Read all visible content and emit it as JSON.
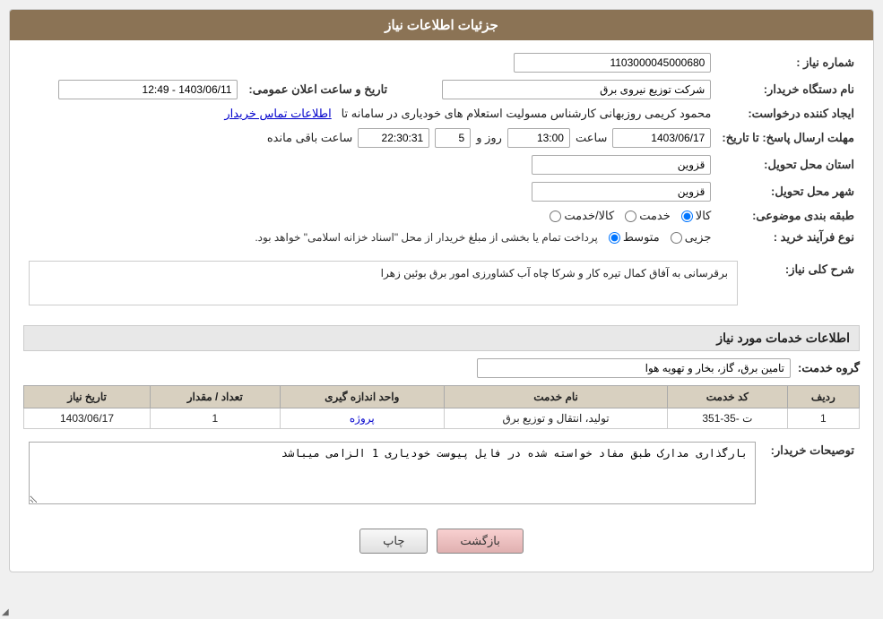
{
  "header": {
    "title": "جزئیات اطلاعات نیاز"
  },
  "fields": {
    "shomareNiaz_label": "شماره نیاز :",
    "shomareNiaz_value": "1103000045000680",
    "namDastgah_label": "نام دستگاه خریدار:",
    "namDastgah_value": "شرکت توزیع نیروی برق",
    "ijadKonande_label": "ایجاد کننده درخواست:",
    "ijadKonande_value": "محمود کریمی روزبهانی کارشناس  مسولیت استعلام های خودیاری در سامانه تا",
    "ijadKonande_link": "اطلاعات تماس خریدار",
    "mohlat_label": "مهلت ارسال پاسخ: تا تاریخ:",
    "mohlat_date": "1403/06/17",
    "mohlat_time_label": "ساعت",
    "mohlat_time": "13:00",
    "mohlat_roz_label": "روز و",
    "mohlat_roz": "5",
    "mohlat_baqi_label": "ساعت باقی مانده",
    "mohlat_baqi": "22:30:31",
    "ostan_label": "استان محل تحویل:",
    "ostan_value": "قزوین",
    "shahr_label": "شهر محل تحویل:",
    "shahr_value": "قزوین",
    "tarigheLabel": "طبقه بندی موضوعی:",
    "tarikhAelan_label": "تاریخ و ساعت اعلان عمومی:",
    "tarikhAelan_value": "1403/06/11 - 12:49",
    "radios_kala_label": "کالا",
    "radios_khadamat_label": "خدمت",
    "radios_kalaKhadamat_label": "کالا/خدمت",
    "noefarayand_label": "نوع فرآیند خرید :",
    "noefarayand_jozi": "جزیی",
    "noefarayand_motavasset": "متوسط",
    "noefarayand_text": "پرداخت تمام یا بخشی از مبلغ خریدار از محل \"اسناد خزانه اسلامی\" خواهد بود.",
    "sharhKoli_label": "شرح کلی نیاز:",
    "sharhKoli_value": "برقرسانی به آفاق کمال تیره کار و شرکا چاه آب کشاورزی امور برق بوئین زهرا",
    "khadamat_label": "اطلاعات خدمات مورد نیاز",
    "grohKhadamat_label": "گروه خدمت:",
    "grohKhadamat_value": "تامین برق، گاز، بخار و تهویه هوا",
    "table": {
      "headers": [
        "ردیف",
        "کد خدمت",
        "نام خدمت",
        "واحد اندازه گیری",
        "تعداد / مقدار",
        "تاریخ نیاز"
      ],
      "rows": [
        {
          "radif": "1",
          "kod": "ت -35-351",
          "nam": "تولید، انتقال و توزیع برق",
          "vahed": "پروژه",
          "tedad": "1",
          "tarikh": "1403/06/17"
        }
      ]
    },
    "tosifKharidar_label": "توصیحات خریدار:",
    "tosifKharidar_value": "بارگذاری مدارک طبق مفاد خواسته شده در فایل پیوست خودیاری 1 الزامی میباشد"
  },
  "buttons": {
    "print_label": "چاپ",
    "back_label": "بازگشت"
  }
}
